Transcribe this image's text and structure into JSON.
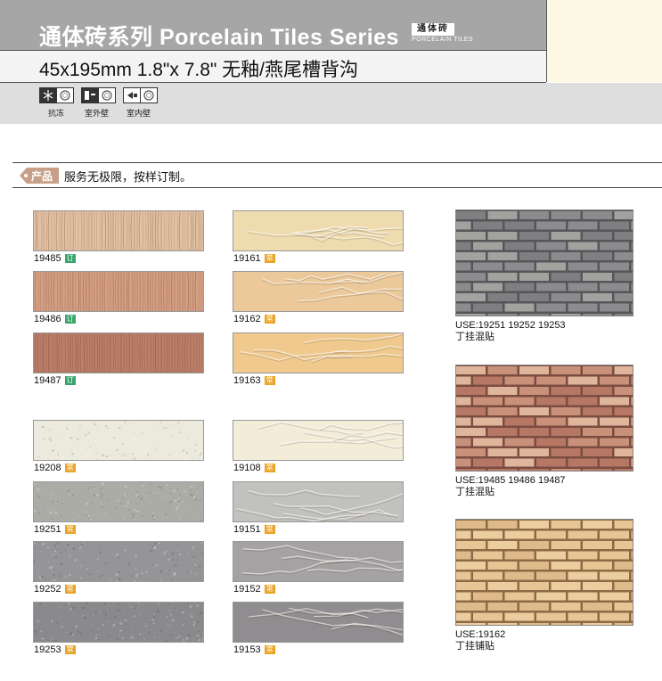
{
  "header": {
    "title": "通体砖系列 Porcelain Tiles Series",
    "logo_cn": "通体砖",
    "logo_en": "PORCELAIN TILES",
    "size_line": "45x195mm 1.8\"x 7.8\" 无釉/燕尾槽背沟"
  },
  "features": [
    {
      "icon": "snowflake-icon",
      "label": "抗冻"
    },
    {
      "icon": "outdoor-wall-icon",
      "label": "室外壁"
    },
    {
      "icon": "indoor-wall-icon",
      "label": "室内壁"
    }
  ],
  "product_tag": {
    "label": "产品",
    "text": "服务无极限，按样订制。"
  },
  "tiles": [
    {
      "code": "19485",
      "badge": "订",
      "badge_color": "#3aa56b",
      "color": "#e3c2a4",
      "texture": "vertical"
    },
    {
      "code": "19486",
      "badge": "订",
      "badge_color": "#3aa56b",
      "color": "#d59f84",
      "texture": "vertical"
    },
    {
      "code": "19487",
      "badge": "订",
      "badge_color": "#3aa56b",
      "color": "#bb7f6a",
      "texture": "vertical"
    },
    {
      "code": "19161",
      "badge": "常",
      "badge_color": "#e8a52a",
      "color": "#eedcaf",
      "texture": "crack"
    },
    {
      "code": "19162",
      "badge": "常",
      "badge_color": "#e8a52a",
      "color": "#ebc99b",
      "texture": "crack"
    },
    {
      "code": "19163",
      "badge": "常",
      "badge_color": "#e8a52a",
      "color": "#f0c98f",
      "texture": "crack"
    },
    {
      "code": "19208",
      "badge": "常",
      "badge_color": "#e8a52a",
      "color": "#ece9dd",
      "texture": "speckle"
    },
    {
      "code": "19251",
      "badge": "常",
      "badge_color": "#e8a52a",
      "color": "#acaca6",
      "texture": "speckle"
    },
    {
      "code": "19252",
      "badge": "常",
      "badge_color": "#e8a52a",
      "color": "#959497",
      "texture": "speckle"
    },
    {
      "code": "19253",
      "badge": "常",
      "badge_color": "#e8a52a",
      "color": "#8a8a8d",
      "texture": "speckle"
    },
    {
      "code": "19108",
      "badge": "常",
      "badge_color": "#e8a52a",
      "color": "#f2ecd9",
      "texture": "crack"
    },
    {
      "code": "19151",
      "badge": "常",
      "badge_color": "#e8a52a",
      "color": "#c1c1bd",
      "texture": "crack"
    },
    {
      "code": "19152",
      "badge": "常",
      "badge_color": "#e8a52a",
      "color": "#a5a2a3",
      "texture": "crack"
    },
    {
      "code": "19153",
      "badge": "常",
      "badge_color": "#e8a52a",
      "color": "#8f8d8f",
      "texture": "crack"
    }
  ],
  "walls": [
    {
      "use": "USE:19251  19252  19253",
      "method": "丁挂混贴",
      "colors": [
        "#7f7f82",
        "#8c8c8f",
        "#a2a29e"
      ],
      "mortar": "#56565a"
    },
    {
      "use": "USE:19485  19486  19487",
      "method": "丁挂混贴",
      "colors": [
        "#c9907a",
        "#b67865",
        "#dfb69b"
      ],
      "mortar": "#7a4d40"
    },
    {
      "use": "USE:19162",
      "method": "丁挂铺贴",
      "colors": [
        "#e8c595",
        "#dfba8a",
        "#eccd9f"
      ],
      "mortar": "#8d6a45"
    }
  ]
}
